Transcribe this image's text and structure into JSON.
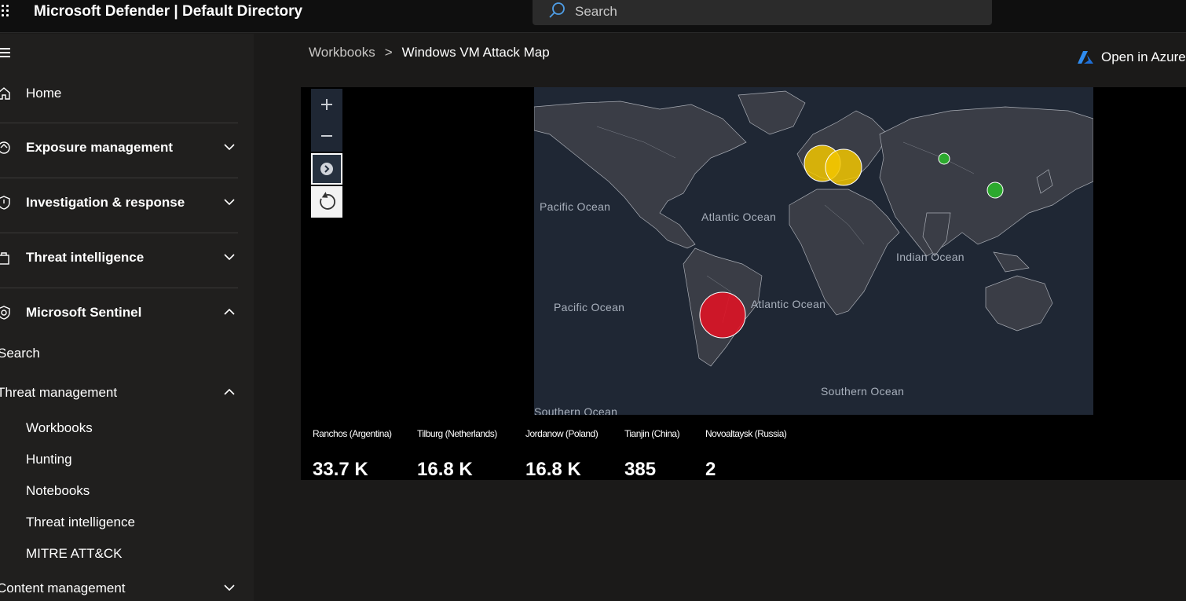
{
  "app": {
    "title": "Microsoft Defender | Default Directory"
  },
  "search": {
    "placeholder": "Search",
    "icon": "search-icon"
  },
  "sidebar": {
    "items": [
      {
        "label": "Home",
        "icon": "home-icon"
      },
      {
        "label": "Exposure management",
        "icon": "exposure-icon",
        "expanded": false
      },
      {
        "label": "Investigation & response",
        "icon": "shield-icon",
        "expanded": false
      },
      {
        "label": "Threat intelligence",
        "icon": "threat-intel-icon",
        "expanded": false
      },
      {
        "label": "Microsoft Sentinel",
        "icon": "sentinel-icon",
        "expanded": true
      }
    ],
    "sentinel_children": {
      "search": "Search",
      "threat_management": "Threat management",
      "threat_management_items": [
        "Workbooks",
        "Hunting",
        "Notebooks",
        "Threat intelligence",
        "MITRE ATT&CK"
      ],
      "content_management": "Content management"
    }
  },
  "breadcrumb": {
    "parent": "Workbooks",
    "current": "Windows VM Attack Map"
  },
  "open_in_azure": "Open in Azure",
  "map": {
    "oceans": [
      "Pacific Ocean",
      "Atlantic Ocean",
      "Pacific Ocean",
      "Atlantic Ocean",
      "Indian Ocean",
      "Southern Ocean",
      "Southern Ocean"
    ],
    "colors": {
      "high": "#e81123",
      "medium": "#f2c500",
      "low": "#2bb52b",
      "land": "#3a3d46",
      "water": "#1f2734"
    }
  },
  "tiles": [
    {
      "name": "Ranchos (Argentina)",
      "value": "33.7 K"
    },
    {
      "name": "Tilburg (Netherlands)",
      "value": "16.8 K"
    },
    {
      "name": "Jordanow (Poland)",
      "value": "16.8 K"
    },
    {
      "name": "Tianjin (China)",
      "value": "385"
    },
    {
      "name": "Novoaltaysk (Russia)",
      "value": "2"
    }
  ]
}
